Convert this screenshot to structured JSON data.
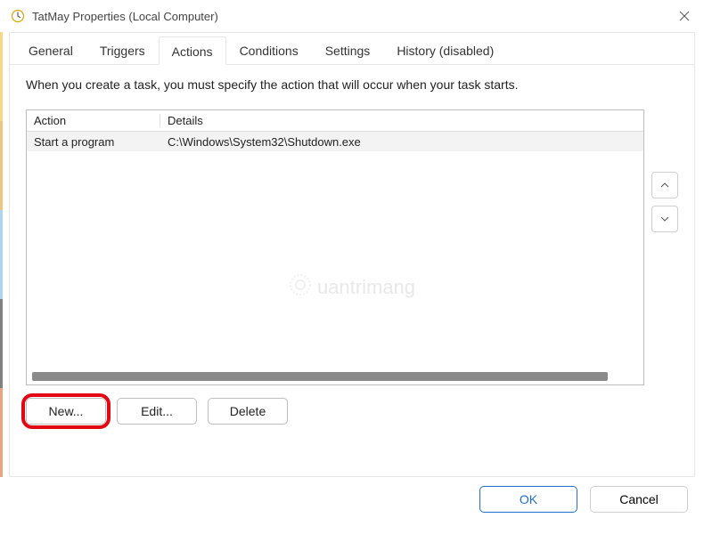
{
  "window": {
    "title": "TatMay Properties (Local Computer)",
    "close_tooltip": "Close"
  },
  "tabs": {
    "general": "General",
    "triggers": "Triggers",
    "actions": "Actions",
    "conditions": "Conditions",
    "settings": "Settings",
    "history": "History (disabled)",
    "active": "actions"
  },
  "actions_tab": {
    "description": "When you create a task, you must specify the action that will occur when your task starts.",
    "columns": {
      "action": "Action",
      "details": "Details"
    },
    "rows": [
      {
        "action": "Start a program",
        "details": "C:\\Windows\\System32\\Shutdown.exe"
      }
    ],
    "buttons": {
      "new": "New...",
      "edit": "Edit...",
      "delete": "Delete"
    },
    "move_up_tooltip": "Move Up",
    "move_down_tooltip": "Move Down"
  },
  "footer": {
    "ok": "OK",
    "cancel": "Cancel"
  },
  "watermark": "uantrimang"
}
